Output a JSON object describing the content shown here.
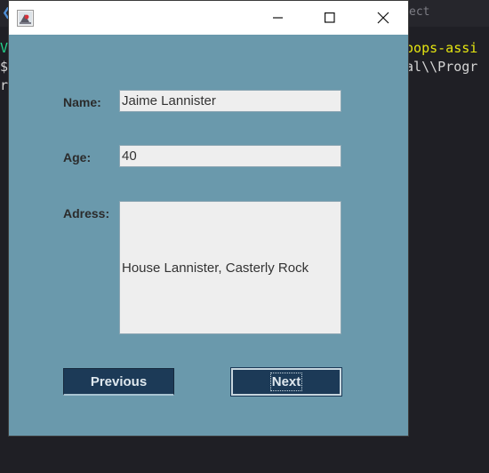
{
  "background": {
    "tab_text": "ect",
    "terminal_lines": [
      {
        "prefix": "V",
        "text": "oops-assi"
      },
      {
        "prefix": "$",
        "text": "al\\\\Progr"
      },
      {
        "prefix": "r",
        "text": ""
      }
    ]
  },
  "window": {
    "icon": "java-app-icon",
    "controls": [
      "minimize-icon",
      "maximize-icon",
      "close-icon"
    ]
  },
  "form": {
    "name_label": "Name:",
    "name_value": "Jaime Lannister",
    "age_label": "Age:",
    "age_value": "40",
    "address_label": "Adress:",
    "address_value": "House Lannister, Casterly Rock"
  },
  "buttons": {
    "previous": "Previous",
    "next": "Next"
  },
  "colors": {
    "panel": "#6a99ac",
    "button": "#1c3a57",
    "field": "#eeeeee"
  }
}
